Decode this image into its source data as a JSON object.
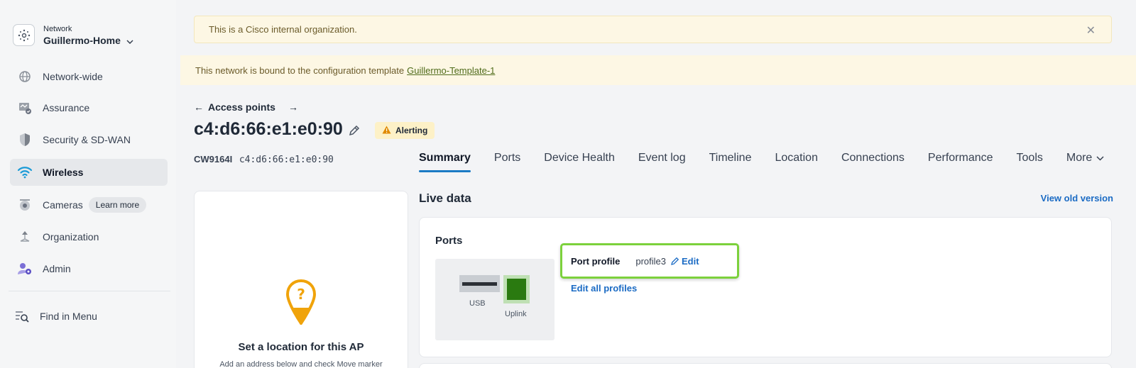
{
  "sidebar": {
    "network_label": "Network",
    "network_name": "Guillermo-Home",
    "items": [
      {
        "label": "Network-wide"
      },
      {
        "label": "Assurance"
      },
      {
        "label": "Security & SD-WAN"
      },
      {
        "label": "Wireless"
      },
      {
        "label": "Cameras",
        "badge": "Learn more"
      },
      {
        "label": "Organization"
      },
      {
        "label": "Admin"
      }
    ],
    "find_in_menu": "Find in Menu"
  },
  "banners": {
    "internal": "This is a Cisco internal organization.",
    "template_text": "This network is bound to the configuration template",
    "template_link": "Guillermo-Template-1"
  },
  "header": {
    "breadcrumb": "Access points",
    "title": "c4:d6:66:e1:e0:90",
    "status_badge": "Alerting",
    "model": "CW9164I",
    "mac": "c4:d6:66:e1:e0:90"
  },
  "tabs": [
    {
      "label": "Summary"
    },
    {
      "label": "Ports"
    },
    {
      "label": "Device Health"
    },
    {
      "label": "Event log"
    },
    {
      "label": "Timeline"
    },
    {
      "label": "Location"
    },
    {
      "label": "Connections"
    },
    {
      "label": "Performance"
    },
    {
      "label": "Tools"
    },
    {
      "label": "More"
    }
  ],
  "location_card": {
    "title": "Set a location for this AP",
    "subtitle": "Add an address below and check Move marker"
  },
  "live_data": {
    "title": "Live data",
    "old_version": "View old version",
    "ports_title": "Ports",
    "usb_label": "USB",
    "uplink_label": "Uplink",
    "port_profile_label": "Port profile",
    "port_profile_value": "profile3",
    "edit_label": "Edit",
    "edit_all_label": "Edit all profiles"
  },
  "colors": {
    "accent": "#1b6bc4",
    "highlight": "#7cd13c",
    "warning": "#f0a30a",
    "banner_bg": "#fdf7e4"
  }
}
